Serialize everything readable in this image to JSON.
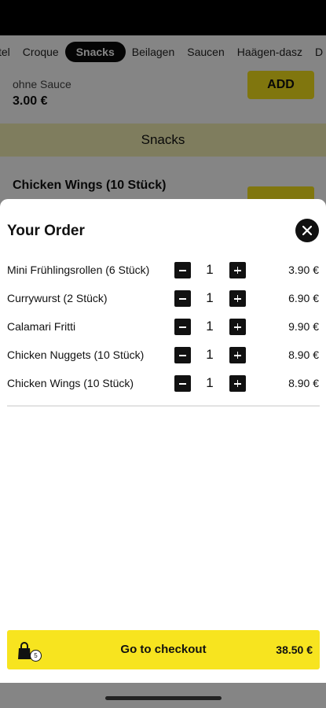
{
  "tabs": [
    {
      "label": "tel"
    },
    {
      "label": "Croque"
    },
    {
      "label": "Snacks",
      "active": true
    },
    {
      "label": "Beilagen"
    },
    {
      "label": "Saucen"
    },
    {
      "label": "Haägen-dasz"
    },
    {
      "label": "D"
    }
  ],
  "background": {
    "prev_item_sub": "ohne Sauce",
    "prev_item_price": "3.00 €",
    "add_label": "ADD",
    "section_title": "Snacks",
    "next_item_name": "Chicken Wings (10 Stück)"
  },
  "sheet": {
    "title": "Your Order",
    "items": [
      {
        "name": "Mini Frühlingsrollen (6 Stück)",
        "qty": "1",
        "price": "3.90 €"
      },
      {
        "name": "Currywurst (2 Stück)",
        "qty": "1",
        "price": "6.90 €"
      },
      {
        "name": "Calamari Fritti",
        "qty": "1",
        "price": "9.90 €"
      },
      {
        "name": "Chicken Nuggets (10 Stück)",
        "qty": "1",
        "price": "8.90 €"
      },
      {
        "name": "Chicken Wings (10 Stück)",
        "qty": "1",
        "price": "8.90 €"
      }
    ]
  },
  "checkout": {
    "label": "Go to checkout",
    "total": "38.50 €",
    "bag_count": "5"
  },
  "icons": {
    "close": "close-icon",
    "minus": "minus-icon",
    "plus": "plus-icon",
    "bag": "shopping-bag-icon"
  },
  "colors": {
    "accent": "#f7e41f",
    "section_bg": "#f3f0b5",
    "button_dark": "#111111"
  }
}
